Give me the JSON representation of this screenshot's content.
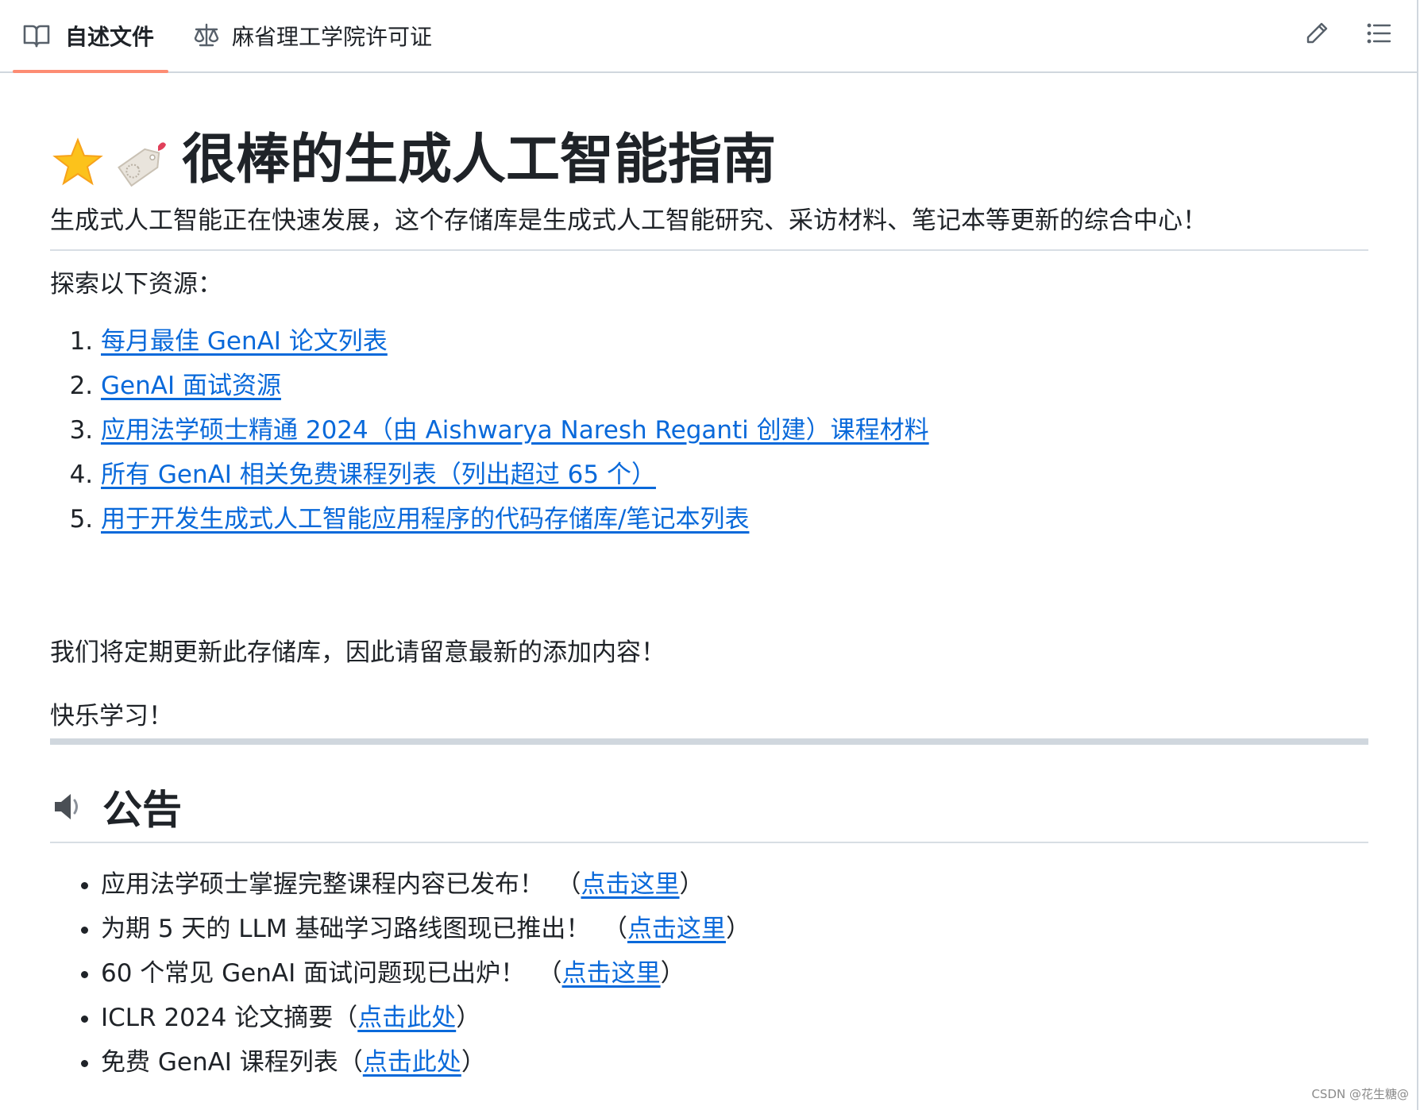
{
  "tabs": {
    "readme_label": "自述文件",
    "license_label": "麻省理工学院许可证"
  },
  "toolbar": {
    "edit_icon": "pencil-icon",
    "toc_icon": "list-icon"
  },
  "readme": {
    "title": "很棒的生成人工智能指南",
    "title_emojis": [
      "star-icon",
      "label-tag-icon"
    ],
    "intro": "生成式人工智能正在快速发展，这个存储库是生成式人工智能研究、采访材料、笔记本等更新的综合中心！",
    "explore_heading": "探索以下资源：",
    "resources": [
      "每月最佳 GenAI 论文列表",
      "GenAI 面试资源",
      "应用法学硕士精通 2024（由 Aishwarya Naresh Reganti 创建）课程材料",
      "所有 GenAI 相关免费课程列表（列出超过 65 个）",
      "用于开发生成式人工智能应用程序的代码存储库/笔记本列表"
    ],
    "update_note": "我们将定期更新此存储库，因此请留意最新的添加内容！",
    "closing": "快乐学习！",
    "announcements_heading": "公告",
    "announcements": [
      {
        "text": "应用法学硕士掌握完整课程内容已发布！",
        "open": "（",
        "link": "点击这里",
        "close": "）"
      },
      {
        "text": "为期 5 天的 LLM 基础学习路线图现已推出！",
        "open": "（",
        "link": "点击这里",
        "close": "）"
      },
      {
        "text": "60 个常见 GenAI 面试问题现已出炉！",
        "open": "（",
        "link": "点击这里",
        "close": "）"
      },
      {
        "text": "ICLR 2024 论文摘要",
        "open": "（",
        "link": "点击此处",
        "close": "）"
      },
      {
        "text": "免费 GenAI 课程列表",
        "open": "（",
        "link": "点击此处",
        "close": "）"
      }
    ]
  },
  "watermark": "CSDN @花生糖@",
  "colors": {
    "link": "#0969da",
    "active_tab_underline": "#fd8c73",
    "text": "#1f2328",
    "border": "#d0d7de"
  }
}
